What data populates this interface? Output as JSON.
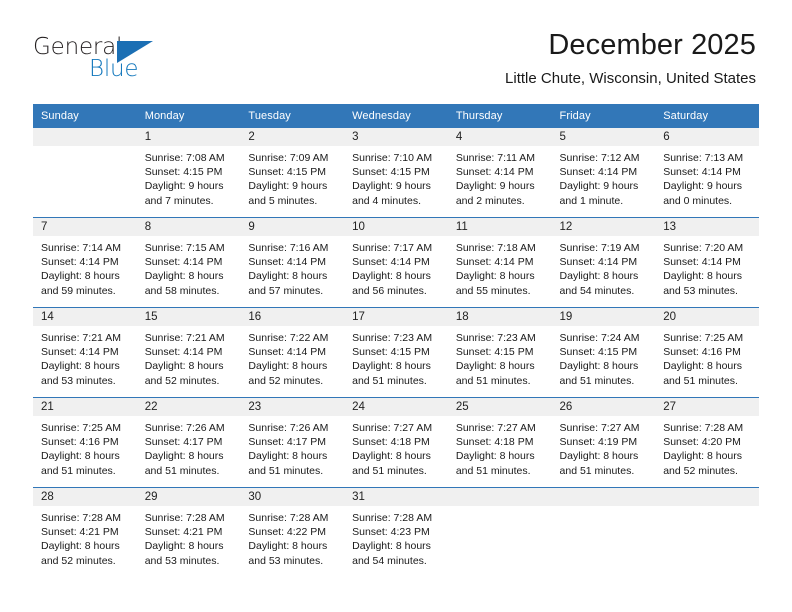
{
  "logo": {
    "word1": "General",
    "word2": "Blue",
    "triangle_color": "#1b6fb4",
    "blue_text_color": "#1277bc"
  },
  "header": {
    "title": "December 2025",
    "subtitle": "Little Chute, Wisconsin, United States"
  },
  "theme": {
    "header_bg": "#3277b8",
    "daynum_bg": "#f0f0f0",
    "grid_line": "#3277b8",
    "text": "#1a1a1a"
  },
  "weekday_headers": [
    "Sunday",
    "Monday",
    "Tuesday",
    "Wednesday",
    "Thursday",
    "Friday",
    "Saturday"
  ],
  "weeks": [
    [
      {
        "day": "",
        "sunrise": "",
        "sunset": "",
        "daylight1": "",
        "daylight2": "",
        "empty": true
      },
      {
        "day": "1",
        "sunrise": "Sunrise: 7:08 AM",
        "sunset": "Sunset: 4:15 PM",
        "daylight1": "Daylight: 9 hours",
        "daylight2": "and 7 minutes."
      },
      {
        "day": "2",
        "sunrise": "Sunrise: 7:09 AM",
        "sunset": "Sunset: 4:15 PM",
        "daylight1": "Daylight: 9 hours",
        "daylight2": "and 5 minutes."
      },
      {
        "day": "3",
        "sunrise": "Sunrise: 7:10 AM",
        "sunset": "Sunset: 4:15 PM",
        "daylight1": "Daylight: 9 hours",
        "daylight2": "and 4 minutes."
      },
      {
        "day": "4",
        "sunrise": "Sunrise: 7:11 AM",
        "sunset": "Sunset: 4:14 PM",
        "daylight1": "Daylight: 9 hours",
        "daylight2": "and 2 minutes."
      },
      {
        "day": "5",
        "sunrise": "Sunrise: 7:12 AM",
        "sunset": "Sunset: 4:14 PM",
        "daylight1": "Daylight: 9 hours",
        "daylight2": "and 1 minute."
      },
      {
        "day": "6",
        "sunrise": "Sunrise: 7:13 AM",
        "sunset": "Sunset: 4:14 PM",
        "daylight1": "Daylight: 9 hours",
        "daylight2": "and 0 minutes."
      }
    ],
    [
      {
        "day": "7",
        "sunrise": "Sunrise: 7:14 AM",
        "sunset": "Sunset: 4:14 PM",
        "daylight1": "Daylight: 8 hours",
        "daylight2": "and 59 minutes."
      },
      {
        "day": "8",
        "sunrise": "Sunrise: 7:15 AM",
        "sunset": "Sunset: 4:14 PM",
        "daylight1": "Daylight: 8 hours",
        "daylight2": "and 58 minutes."
      },
      {
        "day": "9",
        "sunrise": "Sunrise: 7:16 AM",
        "sunset": "Sunset: 4:14 PM",
        "daylight1": "Daylight: 8 hours",
        "daylight2": "and 57 minutes."
      },
      {
        "day": "10",
        "sunrise": "Sunrise: 7:17 AM",
        "sunset": "Sunset: 4:14 PM",
        "daylight1": "Daylight: 8 hours",
        "daylight2": "and 56 minutes."
      },
      {
        "day": "11",
        "sunrise": "Sunrise: 7:18 AM",
        "sunset": "Sunset: 4:14 PM",
        "daylight1": "Daylight: 8 hours",
        "daylight2": "and 55 minutes."
      },
      {
        "day": "12",
        "sunrise": "Sunrise: 7:19 AM",
        "sunset": "Sunset: 4:14 PM",
        "daylight1": "Daylight: 8 hours",
        "daylight2": "and 54 minutes."
      },
      {
        "day": "13",
        "sunrise": "Sunrise: 7:20 AM",
        "sunset": "Sunset: 4:14 PM",
        "daylight1": "Daylight: 8 hours",
        "daylight2": "and 53 minutes."
      }
    ],
    [
      {
        "day": "14",
        "sunrise": "Sunrise: 7:21 AM",
        "sunset": "Sunset: 4:14 PM",
        "daylight1": "Daylight: 8 hours",
        "daylight2": "and 53 minutes."
      },
      {
        "day": "15",
        "sunrise": "Sunrise: 7:21 AM",
        "sunset": "Sunset: 4:14 PM",
        "daylight1": "Daylight: 8 hours",
        "daylight2": "and 52 minutes."
      },
      {
        "day": "16",
        "sunrise": "Sunrise: 7:22 AM",
        "sunset": "Sunset: 4:14 PM",
        "daylight1": "Daylight: 8 hours",
        "daylight2": "and 52 minutes."
      },
      {
        "day": "17",
        "sunrise": "Sunrise: 7:23 AM",
        "sunset": "Sunset: 4:15 PM",
        "daylight1": "Daylight: 8 hours",
        "daylight2": "and 51 minutes."
      },
      {
        "day": "18",
        "sunrise": "Sunrise: 7:23 AM",
        "sunset": "Sunset: 4:15 PM",
        "daylight1": "Daylight: 8 hours",
        "daylight2": "and 51 minutes."
      },
      {
        "day": "19",
        "sunrise": "Sunrise: 7:24 AM",
        "sunset": "Sunset: 4:15 PM",
        "daylight1": "Daylight: 8 hours",
        "daylight2": "and 51 minutes."
      },
      {
        "day": "20",
        "sunrise": "Sunrise: 7:25 AM",
        "sunset": "Sunset: 4:16 PM",
        "daylight1": "Daylight: 8 hours",
        "daylight2": "and 51 minutes."
      }
    ],
    [
      {
        "day": "21",
        "sunrise": "Sunrise: 7:25 AM",
        "sunset": "Sunset: 4:16 PM",
        "daylight1": "Daylight: 8 hours",
        "daylight2": "and 51 minutes."
      },
      {
        "day": "22",
        "sunrise": "Sunrise: 7:26 AM",
        "sunset": "Sunset: 4:17 PM",
        "daylight1": "Daylight: 8 hours",
        "daylight2": "and 51 minutes."
      },
      {
        "day": "23",
        "sunrise": "Sunrise: 7:26 AM",
        "sunset": "Sunset: 4:17 PM",
        "daylight1": "Daylight: 8 hours",
        "daylight2": "and 51 minutes."
      },
      {
        "day": "24",
        "sunrise": "Sunrise: 7:27 AM",
        "sunset": "Sunset: 4:18 PM",
        "daylight1": "Daylight: 8 hours",
        "daylight2": "and 51 minutes."
      },
      {
        "day": "25",
        "sunrise": "Sunrise: 7:27 AM",
        "sunset": "Sunset: 4:18 PM",
        "daylight1": "Daylight: 8 hours",
        "daylight2": "and 51 minutes."
      },
      {
        "day": "26",
        "sunrise": "Sunrise: 7:27 AM",
        "sunset": "Sunset: 4:19 PM",
        "daylight1": "Daylight: 8 hours",
        "daylight2": "and 51 minutes."
      },
      {
        "day": "27",
        "sunrise": "Sunrise: 7:28 AM",
        "sunset": "Sunset: 4:20 PM",
        "daylight1": "Daylight: 8 hours",
        "daylight2": "and 52 minutes."
      }
    ],
    [
      {
        "day": "28",
        "sunrise": "Sunrise: 7:28 AM",
        "sunset": "Sunset: 4:21 PM",
        "daylight1": "Daylight: 8 hours",
        "daylight2": "and 52 minutes."
      },
      {
        "day": "29",
        "sunrise": "Sunrise: 7:28 AM",
        "sunset": "Sunset: 4:21 PM",
        "daylight1": "Daylight: 8 hours",
        "daylight2": "and 53 minutes."
      },
      {
        "day": "30",
        "sunrise": "Sunrise: 7:28 AM",
        "sunset": "Sunset: 4:22 PM",
        "daylight1": "Daylight: 8 hours",
        "daylight2": "and 53 minutes."
      },
      {
        "day": "31",
        "sunrise": "Sunrise: 7:28 AM",
        "sunset": "Sunset: 4:23 PM",
        "daylight1": "Daylight: 8 hours",
        "daylight2": "and 54 minutes."
      },
      {
        "day": "",
        "sunrise": "",
        "sunset": "",
        "daylight1": "",
        "daylight2": "",
        "empty": true
      },
      {
        "day": "",
        "sunrise": "",
        "sunset": "",
        "daylight1": "",
        "daylight2": "",
        "empty": true
      },
      {
        "day": "",
        "sunrise": "",
        "sunset": "",
        "daylight1": "",
        "daylight2": "",
        "empty": true
      }
    ]
  ]
}
